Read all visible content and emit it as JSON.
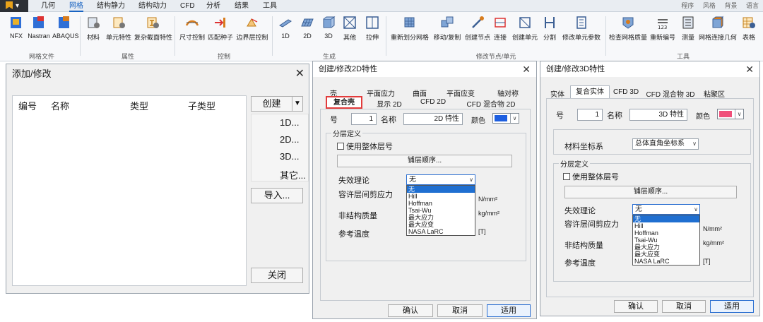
{
  "menubar": {
    "items": [
      "几何",
      "网格",
      "结构静力",
      "结构动力",
      "CFD",
      "分析",
      "结果",
      "工具"
    ],
    "active": "网格",
    "right": [
      "程序",
      "风格",
      "背景",
      "语言"
    ]
  },
  "ribbon": {
    "groups": [
      {
        "caption": "网格文件",
        "buttons": [
          "NFX",
          "Nastran",
          "ABAQUS"
        ]
      },
      {
        "caption": "属性",
        "buttons": [
          "材料",
          "单元特性",
          "复杂截面特性"
        ]
      },
      {
        "caption": "控制",
        "buttons": [
          "尺寸控制",
          "匹配种子",
          "边界层控制"
        ]
      },
      {
        "caption": "生成",
        "buttons": [
          "1D",
          "2D",
          "3D",
          "其他",
          "拉伸"
        ]
      },
      {
        "caption": "修改节点/单元",
        "buttons": [
          "重新划分网格",
          "移动/复制",
          "创建节点",
          "连接",
          "创建单元",
          "分割",
          "修改单元参数"
        ]
      },
      {
        "caption": "工具",
        "buttons": [
          "检查网格质量",
          "重新编号",
          "测量",
          "网格连接几何",
          "表格"
        ]
      }
    ]
  },
  "dlg_add": {
    "title": "添加/修改",
    "close": "✕",
    "columns": [
      "编号",
      "名称",
      "类型",
      "子类型"
    ],
    "create_label": "创建",
    "create_menu": [
      "1D...",
      "2D...",
      "3D...",
      "其它..."
    ],
    "import_label": "导入...",
    "close_label": "关闭"
  },
  "dlg_2d": {
    "title": "创建/修改2D特性",
    "close": "✕",
    "tabs_row1": [
      "壳",
      "平面应力",
      "曲面",
      "平面应变",
      "轴对称"
    ],
    "tabs_row2": [
      "复合壳",
      "显示 2D",
      "CFD 2D",
      "CFD 混合物 2D"
    ],
    "id_label": "号",
    "id_value": "1",
    "name_label": "名称",
    "name_value": "2D 特性",
    "color_label": "颜色",
    "color": "#1e5fe0",
    "group_title": "分层定义",
    "use_global_ply": "使用整体层号",
    "ply_order": "铺层顺序...",
    "failure_label": "失效理论",
    "failure_value": "无",
    "failure_options": [
      "无",
      "Hill",
      "Hoffman",
      "Tsai-Wu",
      "最大应力",
      "最大应变",
      "NASA LaRC"
    ],
    "interlaminar_label": "容许层间剪应力",
    "interlaminar_unit": "N/mm²",
    "nonstruct_label": "非结构质量",
    "nonstruct_unit": "kg/mm²",
    "ref_temp_label": "参考温度",
    "ref_temp_unit": "[T]",
    "ok": "确认",
    "cancel": "取消",
    "apply": "适用"
  },
  "dlg_3d": {
    "title": "创建/修改3D特性",
    "close": "✕",
    "tabs": [
      "实体",
      "复合实体",
      "CFD 3D",
      "CFD 混合物 3D",
      "粘聚区"
    ],
    "id_label": "号",
    "id_value": "1",
    "name_label": "名称",
    "name_value": "3D 特性",
    "color_label": "颜色",
    "color": "#f0507a",
    "coord_label": "材料坐标系",
    "coord_value": "总体直角坐标系",
    "group_title": "分层定义",
    "use_global_ply": "使用整体层号",
    "ply_order": "铺层顺序...",
    "failure_label": "失效理论",
    "failure_value": "无",
    "failure_options": [
      "无",
      "Hill",
      "Hoffman",
      "Tsai-Wu",
      "最大应力",
      "最大应变",
      "NASA LaRC"
    ],
    "interlaminar_label": "容许层间剪应力",
    "interlaminar_unit": "N/mm²",
    "nonstruct_label": "非结构质量",
    "nonstruct_unit": "kg/mm²",
    "ref_temp_label": "参考温度",
    "ref_temp_unit": "[T]",
    "ok": "确认",
    "cancel": "取消",
    "apply": "适用"
  }
}
